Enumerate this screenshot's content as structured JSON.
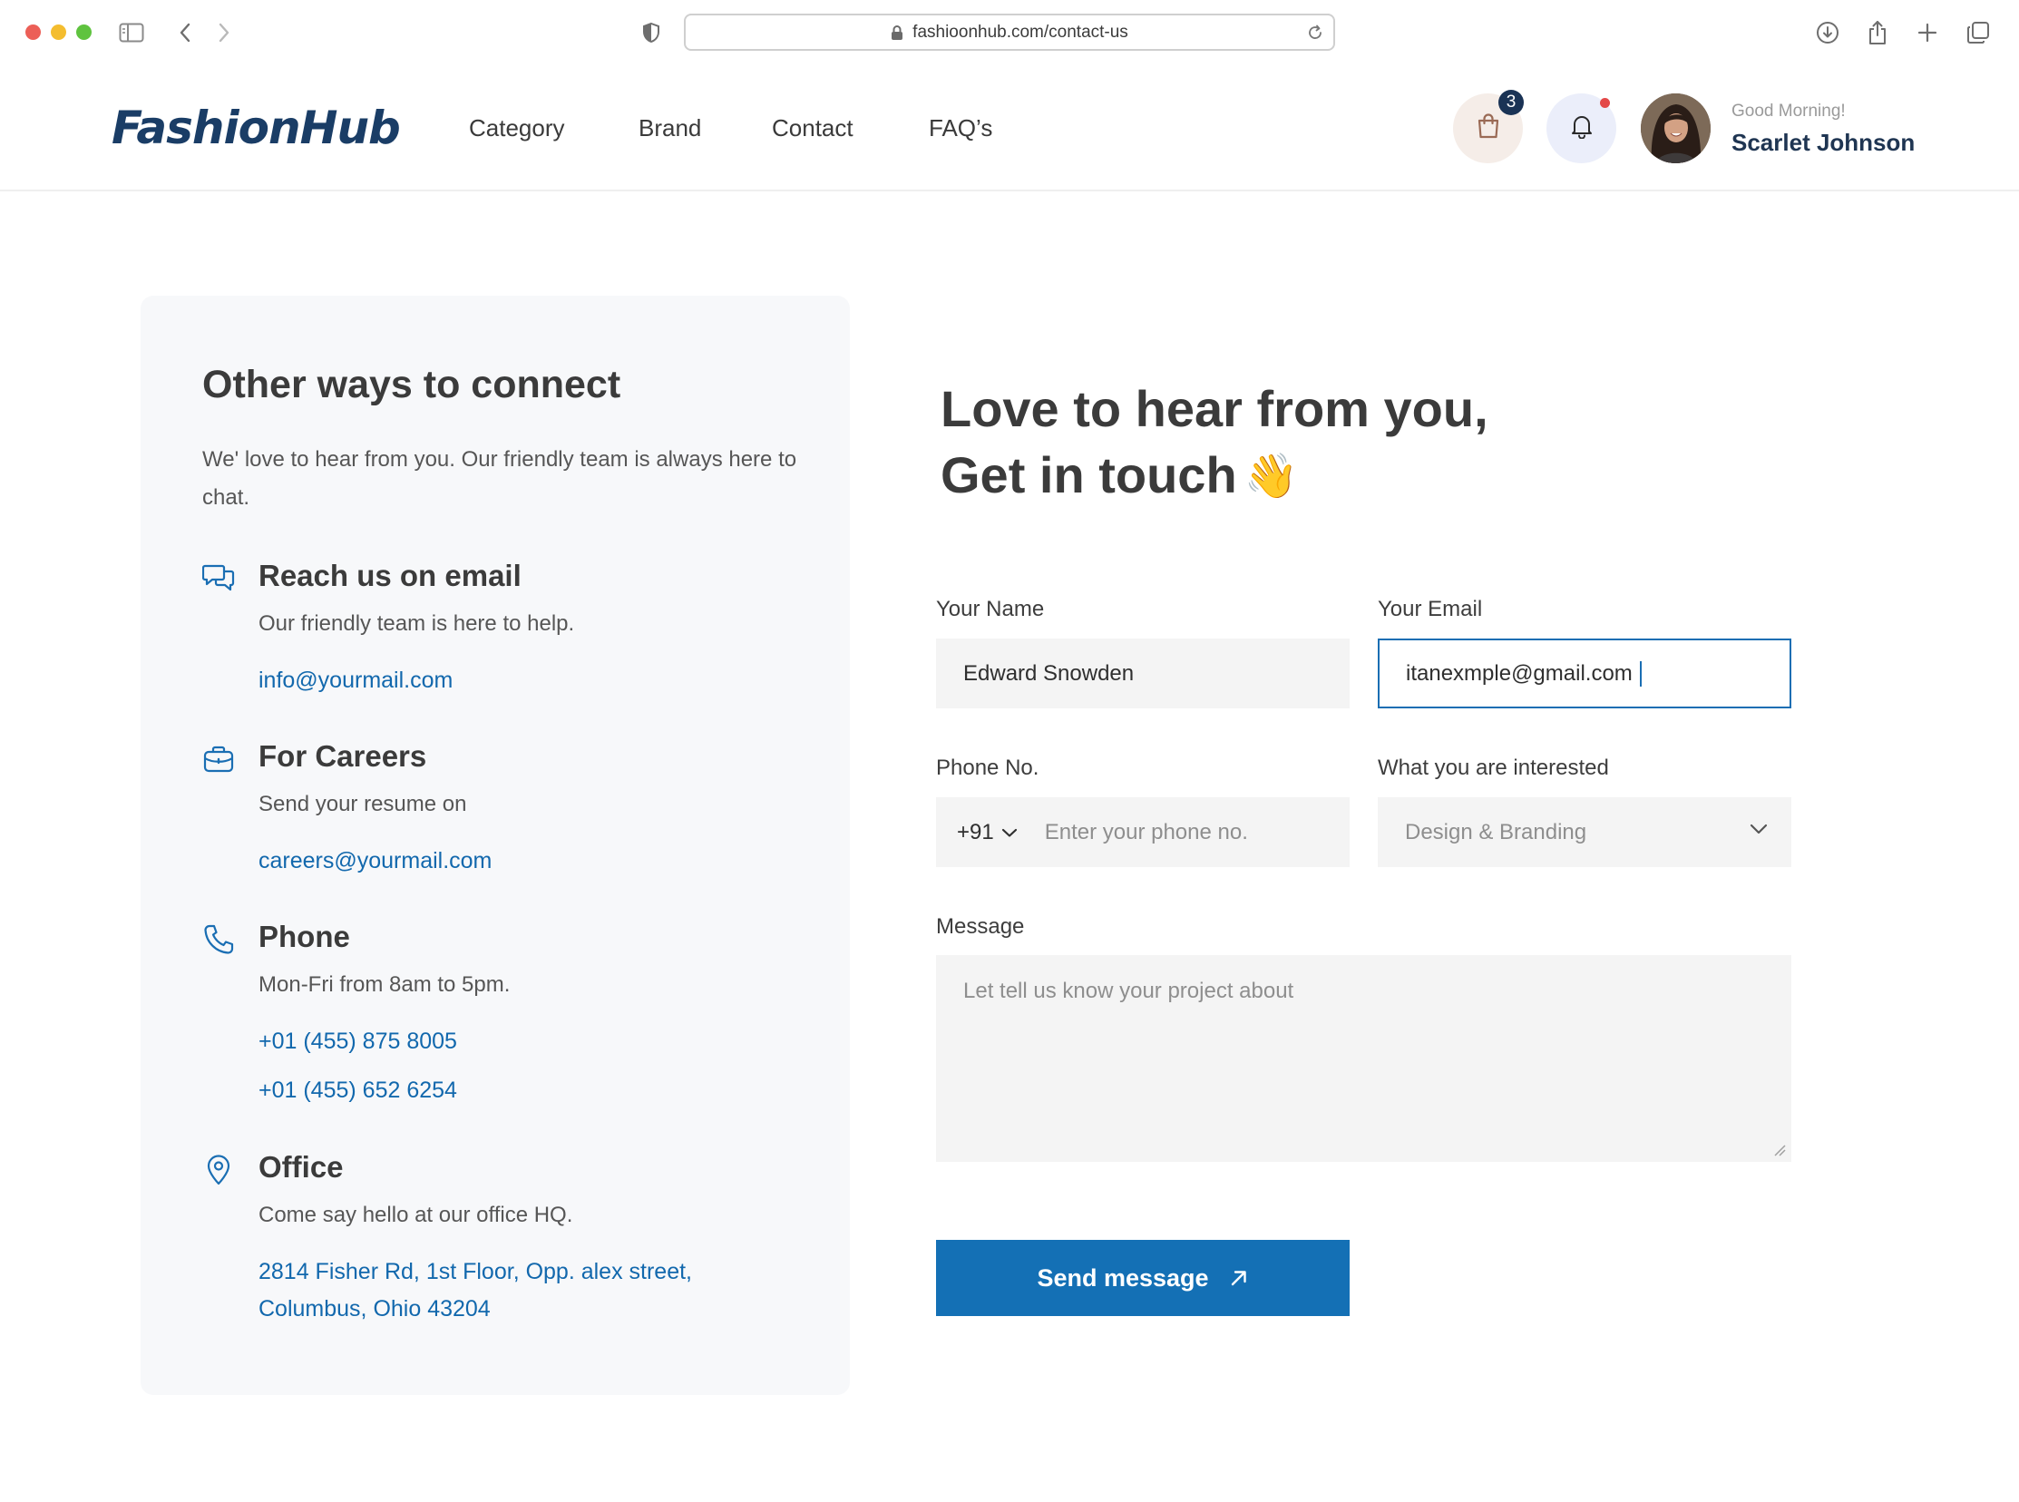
{
  "browser": {
    "url": "fashioonhub.com/contact-us"
  },
  "header": {
    "logo": "FashionHub",
    "nav": [
      "Category",
      "Brand",
      "Contact",
      "FAQ’s"
    ],
    "cart_count": "3",
    "greeting": "Good Morning!",
    "user_name": "Scarlet Johnson"
  },
  "info": {
    "title": "Other ways to connect",
    "subtitle": "We' love to hear from you. Our friendly team is always here to chat.",
    "email": {
      "title": "Reach us on email",
      "text": "Our friendly team is here to help.",
      "link": "info@yourmail.com"
    },
    "careers": {
      "title": "For Careers",
      "text": "Send your resume on",
      "link": "careers@yourmail.com"
    },
    "phone": {
      "title": "Phone",
      "text": "Mon-Fri from 8am to 5pm.",
      "numbers": [
        "+01 (455) 875 8005",
        "+01 (455) 652 6254"
      ]
    },
    "office": {
      "title": "Office",
      "text": "Come say hello at our office HQ.",
      "address_line1": "2814 Fisher Rd, 1st Floor, Opp. alex street,",
      "address_line2": "Columbus, Ohio 43204"
    }
  },
  "form": {
    "title_line1": "Love to hear from you,",
    "title_line2": "Get in touch",
    "title_emoji": "👋",
    "name_label": "Your Name",
    "name_value": "Edward Snowden",
    "email_label": "Your Email",
    "email_value": "itanexmple@gmail.com",
    "phone_label": "Phone No.",
    "country_code": "+91",
    "phone_placeholder": "Enter your phone no.",
    "interest_label": "What you are interested",
    "interest_value": "Design & Branding",
    "message_label": "Message",
    "message_placeholder": "Let tell us know your project about",
    "submit_label": "Send message"
  },
  "colors": {
    "brand_navy": "#1a3d66",
    "link_blue": "#1268ad",
    "button_blue": "#1470b5"
  }
}
